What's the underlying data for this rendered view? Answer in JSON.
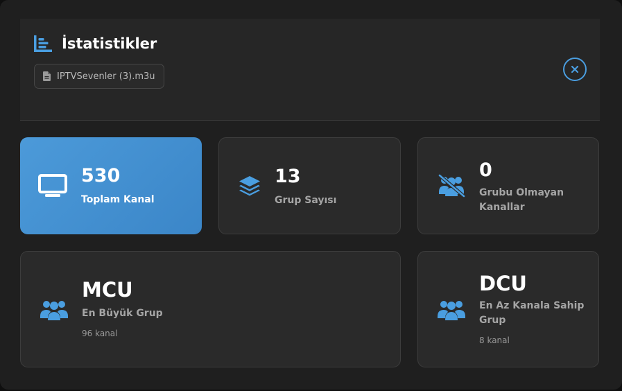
{
  "header": {
    "title": "İstatistikler",
    "file_name": "IPTVSevenler (3).m3u",
    "title_icon": "chart-bar-icon",
    "file_icon": "file-icon",
    "close_icon": "close-icon"
  },
  "stats": [
    {
      "value": "530",
      "label": "Toplam Kanal",
      "icon": "tv-icon"
    },
    {
      "value": "13",
      "label": "Grup Sayısı",
      "icon": "layers-icon"
    },
    {
      "value": "0",
      "label": "Grubu Olmayan Kanallar",
      "icon": "users-slash-icon"
    }
  ],
  "groups": [
    {
      "value": "MCU",
      "label": "En Büyük Grup",
      "sub": "96 kanal",
      "icon": "users-icon"
    },
    {
      "value": "DCU",
      "label": "En Az Kanala Sahip Grup",
      "sub": "8 kanal",
      "icon": "users-icon"
    }
  ],
  "colors": {
    "accent": "#4a9ee0",
    "card_bg": "#2a2a2a",
    "modal_bg": "#1f1f1f"
  }
}
